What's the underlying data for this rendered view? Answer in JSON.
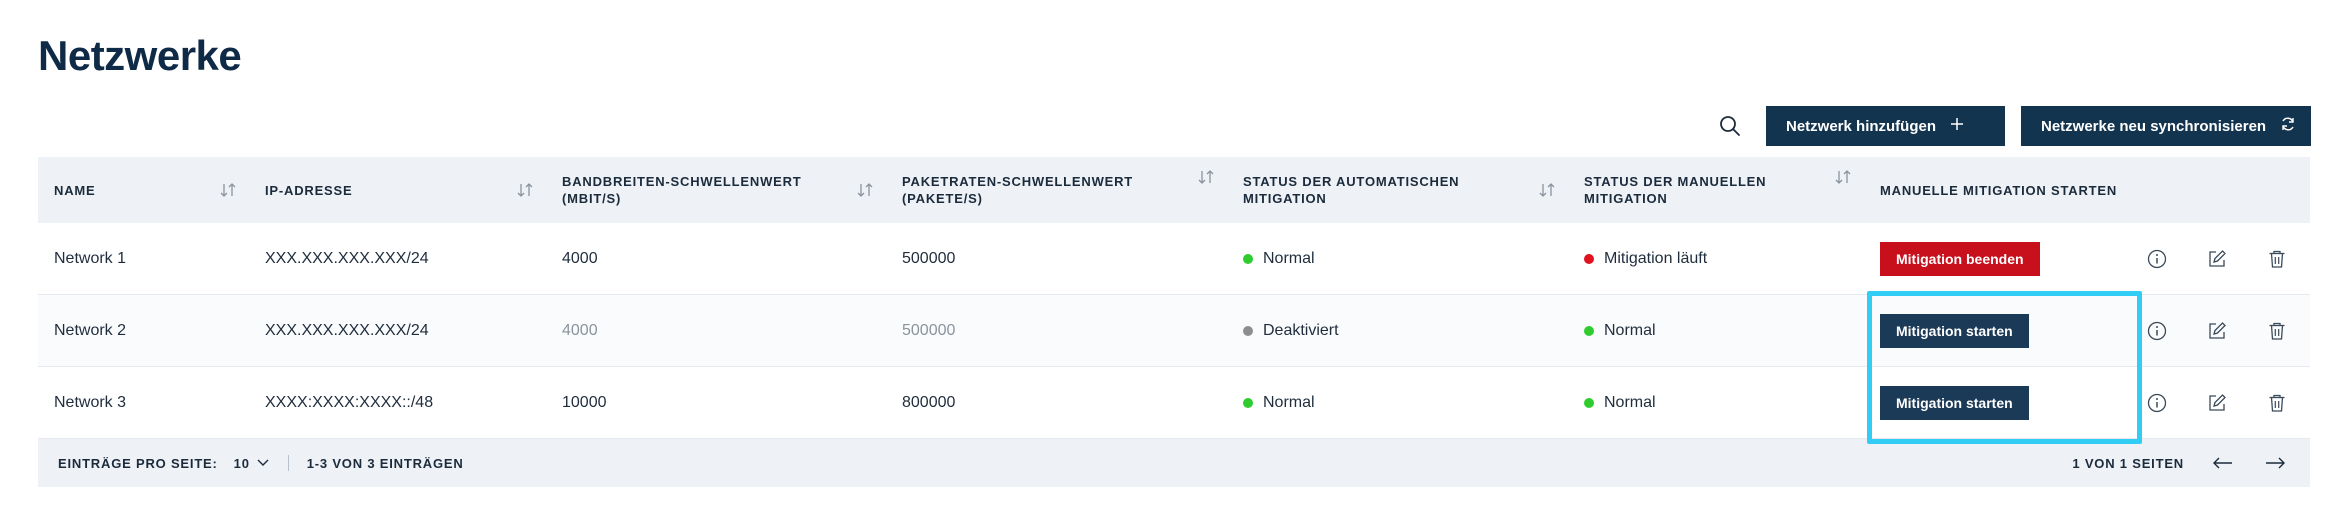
{
  "page": {
    "title": "Netzwerke"
  },
  "toolbar": {
    "search_icon": "search-icon",
    "add_label": "Netzwerk hinzufügen",
    "sync_label": "Netzwerke neu synchronisieren"
  },
  "table": {
    "headers": [
      "NAME",
      "IP-ADRESSE",
      "BANDBREITEN-SCHWELLENWERT (MBIT/S)",
      "PAKETRATEN-SCHWELLENWERT (PAKETE/S)",
      "STATUS DER AUTOMATISCHEN MITIGATION",
      "STATUS DER MANUELLEN MITIGATION",
      "MANUELLE MITIGATION STARTEN"
    ],
    "rows": [
      {
        "name": "Network 1",
        "ip": "XXX.XXX.XXX.XXX/24",
        "bandwidth": "4000",
        "packets": "500000",
        "auto_status": "Normal",
        "manual_status": "Mitigation läuft",
        "action": "Mitigation beenden"
      },
      {
        "name": "Network 2",
        "ip": "XXX.XXX.XXX.XXX/24",
        "bandwidth": "4000",
        "packets": "500000",
        "auto_status": "Deaktiviert",
        "manual_status": "Normal",
        "action": "Mitigation starten"
      },
      {
        "name": "Network 3",
        "ip": "XXXX:XXXX:XXXX::/48",
        "bandwidth": "10000",
        "packets": "800000",
        "auto_status": "Normal",
        "manual_status": "Normal",
        "action": "Mitigation starten"
      }
    ]
  },
  "footer": {
    "per_page_label": "EINTRÄGE PRO SEITE:",
    "per_page_value": "10",
    "range": "1-3 VON 3 EINTRÄGEN",
    "pages": "1 VON 1 SEITEN"
  },
  "colors": {
    "green": "#2ecc2e",
    "red": "#e0121e",
    "grey": "#8e8e8e",
    "navy": "#13344f",
    "danger": "#c8101d",
    "highlight": "#32cdf5"
  }
}
